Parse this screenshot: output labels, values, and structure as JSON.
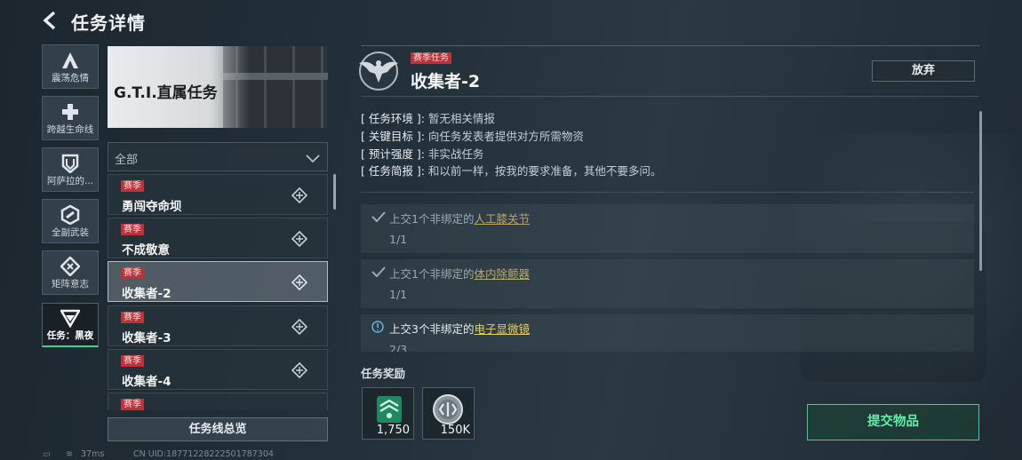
{
  "header": {
    "title": "任务详情"
  },
  "sidebar": {
    "items": [
      {
        "label": "震荡危情",
        "icon": "triangle-a-icon"
      },
      {
        "label": "跨越生命线",
        "icon": "medical-cross-icon"
      },
      {
        "label": "阿萨拉的...",
        "icon": "shield-icon"
      },
      {
        "label": "全副武装",
        "icon": "gear-hex-icon"
      },
      {
        "label": "矩阵意志",
        "icon": "diamond-chevron-icon"
      },
      {
        "label": "任务：黑夜",
        "icon": "v-chevron-icon"
      }
    ]
  },
  "banner": {
    "title": "G.T.I.直属任务"
  },
  "filter": {
    "selected": "全部"
  },
  "quests": [
    {
      "tag": "赛季",
      "name": "勇闯夺命坝"
    },
    {
      "tag": "赛季",
      "name": "不成敬意"
    },
    {
      "tag": "赛季",
      "name": "收集者-2"
    },
    {
      "tag": "赛季",
      "name": "收集者-3"
    },
    {
      "tag": "赛季",
      "name": "收集者-4"
    },
    {
      "tag": "赛季",
      "name": ""
    }
  ],
  "overview_button": "任务线总览",
  "statusbar": {
    "ping": "37ms",
    "uid": "CN UID:18771228222501787304"
  },
  "detail": {
    "tag": "赛季任务",
    "title": "收集者-2",
    "abandon": "放弃",
    "info": [
      {
        "key": "[ 任务环境 ]:",
        "value": "暂无相关情报"
      },
      {
        "key": "[ 关键目标 ]:",
        "value": "向任务发表者提供对方所需物资"
      },
      {
        "key": "[ 预计强度 ]:",
        "value": "非实战任务"
      },
      {
        "key": "[ 任务简报 ]:",
        "value": "和以前一样，按我的要求准备，其他不要多问。"
      }
    ],
    "objectives": [
      {
        "prefix": "上交1个非绑定的",
        "item": "人工膝关节",
        "progress": "1/1",
        "done": true
      },
      {
        "prefix": "上交1个非绑定的",
        "item": "体内除颤器",
        "progress": "1/1",
        "done": true
      },
      {
        "prefix": "上交3个非绑定的",
        "item": "电子显微镜",
        "progress": "2/3",
        "done": false
      }
    ],
    "reward_label": "任务奖励",
    "rewards": [
      {
        "value": "1,750",
        "icon": "experience-badge-icon"
      },
      {
        "value": "150K",
        "icon": "coin-icon"
      }
    ],
    "submit": "提交物品"
  },
  "colors": {
    "accent": "#3fd28e",
    "season_tag": "#b8343a",
    "item_link": "#e9cf5b"
  }
}
